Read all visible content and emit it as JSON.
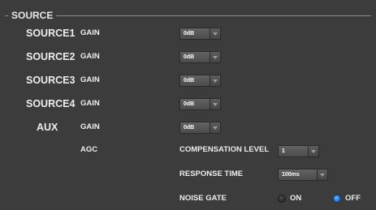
{
  "section": {
    "title": "SOURCE"
  },
  "sources": [
    {
      "name": "SOURCE1",
      "param": "GAIN",
      "value": "0dB"
    },
    {
      "name": "SOURCE2",
      "param": "GAIN",
      "value": "0dB"
    },
    {
      "name": "SOURCE3",
      "param": "GAIN",
      "value": "0dB"
    },
    {
      "name": "SOURCE4",
      "param": "GAIN",
      "value": "0dB"
    },
    {
      "name": "AUX",
      "param": "GAIN",
      "value": "0dB"
    }
  ],
  "agc": {
    "label": "AGC",
    "compensation_level": {
      "label": "COMPENSATION LEVEL",
      "value": "1"
    },
    "response_time": {
      "label": "RESPONSE TIME",
      "value": "100ms"
    },
    "noise_gate": {
      "label": "NOISE GATE",
      "on_label": "ON",
      "off_label": "OFF",
      "selected": "OFF"
    }
  },
  "colors": {
    "background": "#3c3c3c",
    "text": "#ededed",
    "radio_selected": "#1f6fd6"
  },
  "icons": {
    "dropdown_arrow": "chevron-down-icon",
    "radio_off": "radio-unselected-icon",
    "radio_on": "radio-selected-icon"
  }
}
